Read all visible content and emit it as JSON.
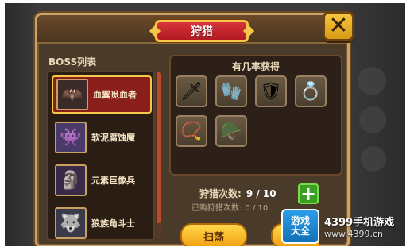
{
  "dialog": {
    "title": "狩猎",
    "close_label": "✕"
  },
  "boss_list": {
    "title": "BOSS列表",
    "items": [
      {
        "name": "血翼觅血者",
        "sub": "",
        "icon": "🦇",
        "bg": "#3a2a2a",
        "selected": true
      },
      {
        "name": "软泥腐蚀魔",
        "sub": "",
        "icon": "👾",
        "bg": "#4a3a6a",
        "selected": false
      },
      {
        "name": "元素巨像兵",
        "sub": "",
        "icon": "🗿",
        "bg": "#3a2a4a",
        "selected": false
      },
      {
        "name": "狼族角斗士",
        "sub": "",
        "icon": "🐺",
        "bg": "#3a3a4a",
        "selected": false
      }
    ]
  },
  "drops": {
    "title": "有几率获得",
    "items": [
      {
        "name": "sword-icon",
        "glyph": "🗡"
      },
      {
        "name": "bracer-icon",
        "glyph": "🧤"
      },
      {
        "name": "shield-icon",
        "glyph": "🛡"
      },
      {
        "name": "ring-icon",
        "glyph": "💍"
      },
      {
        "name": "amulet-icon",
        "glyph": "📿"
      },
      {
        "name": "winged-helm-icon",
        "glyph": "🪖"
      }
    ]
  },
  "hunt": {
    "count_label": "狩猎次数:",
    "count_value": "9 / 10",
    "bought_label": "已购狩猎次数:",
    "bought_value": "0 / 10",
    "plus_label": "+"
  },
  "buttons": {
    "sweep_label": "扫荡"
  },
  "watermark": {
    "logo_line1": "游戏",
    "logo_line2": "大全",
    "line1": "4399手机游戏",
    "line2": "www.4399.cn"
  },
  "colors": {
    "accent_gold": "#f4c84a",
    "title_red": "#d8333a",
    "plus_green": "#3aa024"
  }
}
